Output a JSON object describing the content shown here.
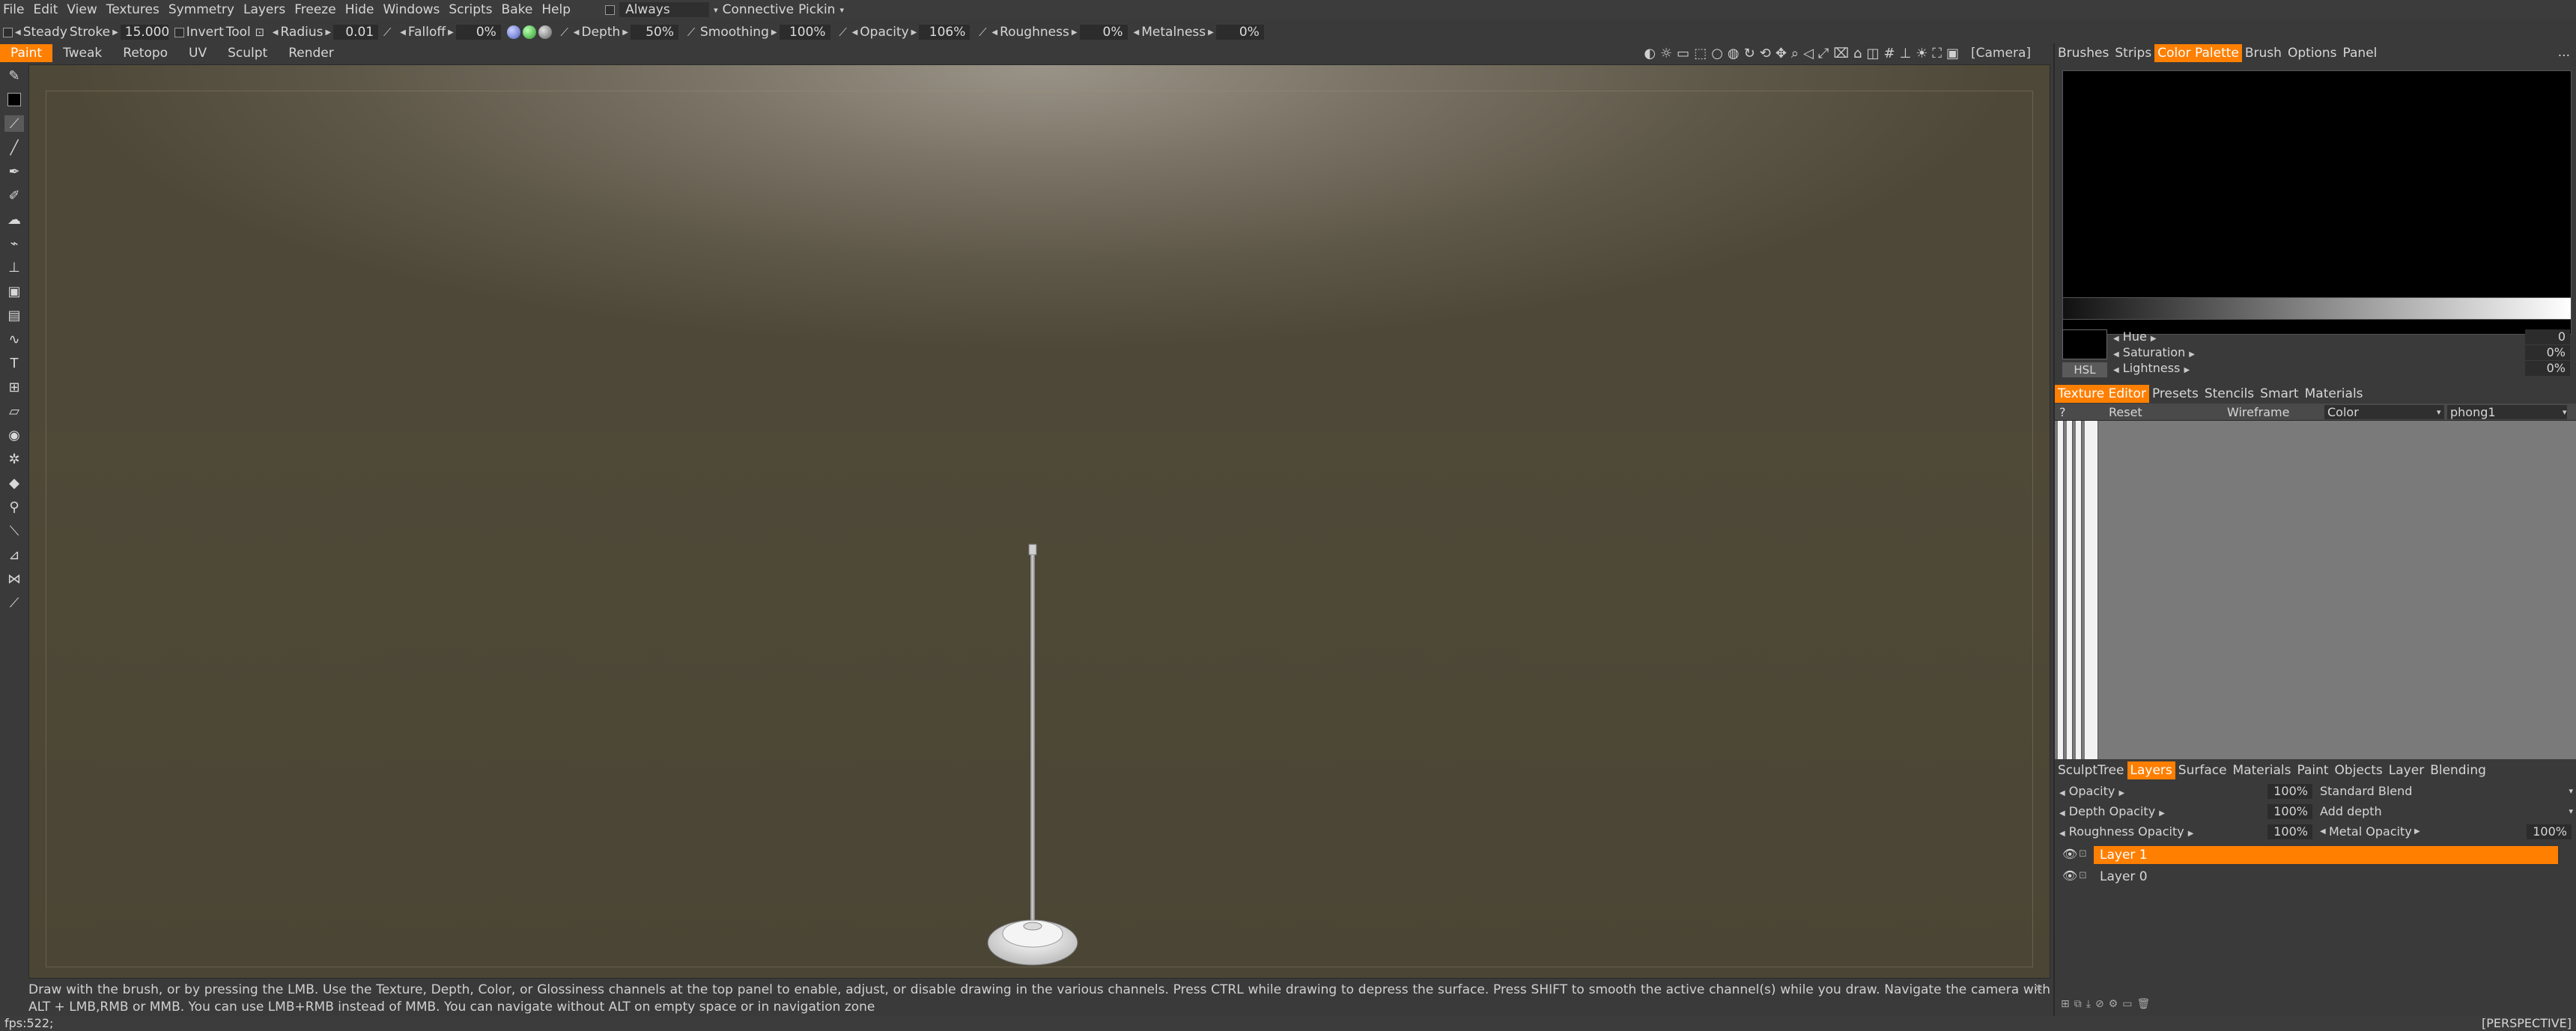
{
  "menu": [
    "File",
    "Edit",
    "View",
    "Textures",
    "Symmetry",
    "Layers",
    "Freeze",
    "Hide",
    "Windows",
    "Scripts",
    "Bake",
    "Help"
  ],
  "menu_extra": {
    "always_label": "Always",
    "connective_label": "Connective",
    "pickin_label": "Pickin"
  },
  "tool_options": {
    "steady_stroke_label": "Steady",
    "stroke_label": "Stroke",
    "stroke_value": "15.000",
    "invert_tool_label": "Invert",
    "tool_label": "Tool",
    "radius_label": "Radius",
    "radius_value": "0.01",
    "falloff_label": "Falloff",
    "falloff_value": "0%",
    "depth_label": "Depth",
    "depth_value": "50%",
    "smoothing_label": "Smoothing",
    "smoothing_value": "100%",
    "opacity_label": "Opacity",
    "opacity_value": "106%",
    "roughness_label": "Roughness",
    "roughness_value": "0%",
    "metalness_label": "Metalness",
    "metalness_value": "0%"
  },
  "rooms": [
    "Paint",
    "Tweak",
    "Retopo",
    "UV",
    "Sculpt",
    "Render"
  ],
  "active_room": "Paint",
  "camera_label": "[Camera]",
  "hint_text": "Draw with the brush, or by pressing the LMB. Use the Texture, Depth, Color, or Glossiness channels at the top panel to enable, adjust, or disable drawing in the various channels. Press CTRL while drawing to depress the surface. Press SHIFT to smooth the active channel(s) while you draw. Navigate the camera with ALT + LMB,RMB or MMB. You can use LMB+RMB instead of MMB. You can navigate without ALT on empty space or in navigation zone",
  "status": {
    "fps": "fps:522;",
    "view_mode": "[PERSPECTIVE]"
  },
  "color_panel": {
    "tabs": [
      "Brushes",
      "Strips",
      "Color Palette",
      "Brush",
      "Options",
      "Panel"
    ],
    "active_tab": "Color Palette",
    "more": "...",
    "hsl_button": "HSL",
    "hue_label": "Hue",
    "hue_value": "0",
    "saturation_label": "Saturation",
    "saturation_value": "0%",
    "lightness_label": "Lightness",
    "lightness_value": "0%",
    "current_color": "#000000"
  },
  "texture_panel": {
    "tabs": [
      "Texture Editor",
      "Presets",
      "Stencils",
      "Smart",
      "Materials"
    ],
    "active_tab": "Texture Editor",
    "header": {
      "help": "?",
      "reset": "Reset",
      "wireframe": "Wireframe",
      "channel": "Color",
      "material": "phong1"
    }
  },
  "layers_panel": {
    "tabs": [
      "SculptTree",
      "Layers",
      "Surface",
      "Materials",
      "Paint",
      "Objects",
      "Layer",
      "Blending"
    ],
    "active_tab": "Layers",
    "opacity_label": "Opacity",
    "opacity_value": "100%",
    "blend_mode": "Standard Blend",
    "depth_opacity_label": "Depth Opacity",
    "depth_opacity_value": "100%",
    "depth_mode": "Add depth",
    "roughness_opacity_label": "Roughness Opacity",
    "roughness_opacity_value": "100%",
    "metal_opacity_label": "Metal Opacity",
    "metal_opacity_value": "100%",
    "layers": [
      {
        "name": "Layer 1",
        "active": true
      },
      {
        "name": "Layer 0",
        "active": false
      }
    ]
  },
  "colors": {
    "accent": "#ff7f00",
    "background": "#3a3a3a"
  }
}
